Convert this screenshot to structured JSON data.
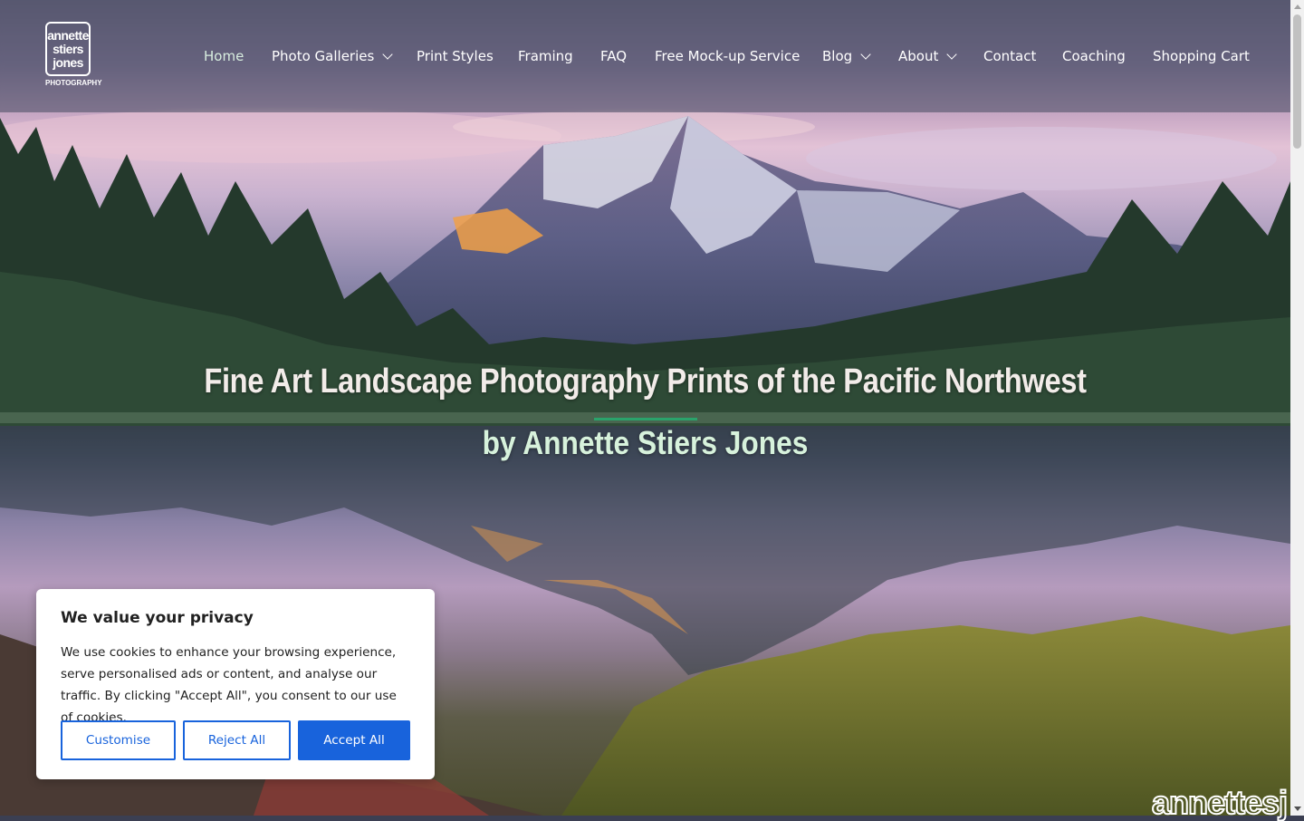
{
  "logo": {
    "line1": "annette",
    "line2": "stiers",
    "line3": "jones",
    "sub": "PHOTOGRAPHY"
  },
  "nav": {
    "items": [
      {
        "label": "Home",
        "active": true,
        "dropdown": false
      },
      {
        "label": "Photo Galleries",
        "active": false,
        "dropdown": true
      },
      {
        "label": "Print Styles",
        "active": false,
        "dropdown": false
      },
      {
        "label": "Framing",
        "active": false,
        "dropdown": false
      },
      {
        "label": "FAQ",
        "active": false,
        "dropdown": false
      },
      {
        "label": "Free Mock-up Service",
        "active": false,
        "dropdown": false
      },
      {
        "label": "Blog",
        "active": false,
        "dropdown": true
      },
      {
        "label": "About",
        "active": false,
        "dropdown": true
      },
      {
        "label": "Contact",
        "active": false,
        "dropdown": false
      },
      {
        "label": "Coaching",
        "active": false,
        "dropdown": false
      },
      {
        "label": "Shopping Cart",
        "active": false,
        "dropdown": false
      }
    ]
  },
  "hero": {
    "title": "Fine Art Landscape Photography Prints of the Pacific Northwest",
    "subtitle": "by Annette Stiers Jones",
    "watermark": "annettesj"
  },
  "cookie": {
    "title": "We value your privacy",
    "text": "We use cookies to enhance your browsing experience, serve personalised ads or content, and analyse our traffic. By clicking \"Accept All\", you consent to our use of cookies.",
    "customise": "Customise",
    "reject": "Reject All",
    "accept": "Accept All"
  },
  "colors": {
    "accent_green": "#2aa36b",
    "button_blue": "#1863dc",
    "active_nav": "#d8eedf"
  }
}
